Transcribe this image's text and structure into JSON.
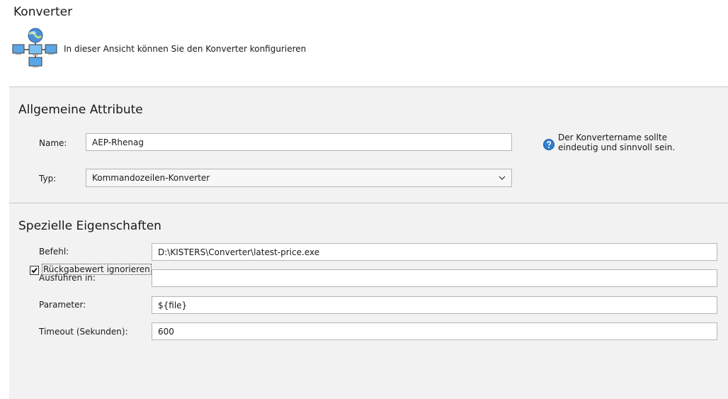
{
  "header": {
    "title": "Konverter",
    "description": "In dieser Ansicht können Sie den Konverter konfigurieren",
    "icon": "network-computers-icon"
  },
  "general": {
    "title": "Allgemeine Attribute",
    "name_label": "Name:",
    "name_value": "AEP-Rhenag",
    "type_label": "Typ:",
    "type_value": "Kommandozeilen-Konverter",
    "hint_icon": "help-icon",
    "hint_line1": "Der Konvertername sollte",
    "hint_line2": "eindeutig und sinnvoll sein."
  },
  "special": {
    "title": "Spezielle Eigenschaften",
    "command_label": "Befehl:",
    "command_value": "D:\\KISTERS\\Converter\\latest-price.exe",
    "workdir_label": "Ausführen in:",
    "workdir_value": "",
    "params_label": "Parameter:",
    "params_value": "${file}",
    "timeout_label": "Timeout (Sekunden):",
    "timeout_value": "600",
    "ignore_return_label": "Rückgabewert ignorieren",
    "ignore_return_checked": true
  },
  "colors": {
    "content_background": "#f2f2f2",
    "separator": "#c9c9c9",
    "help_icon": "#2f7fd0"
  }
}
